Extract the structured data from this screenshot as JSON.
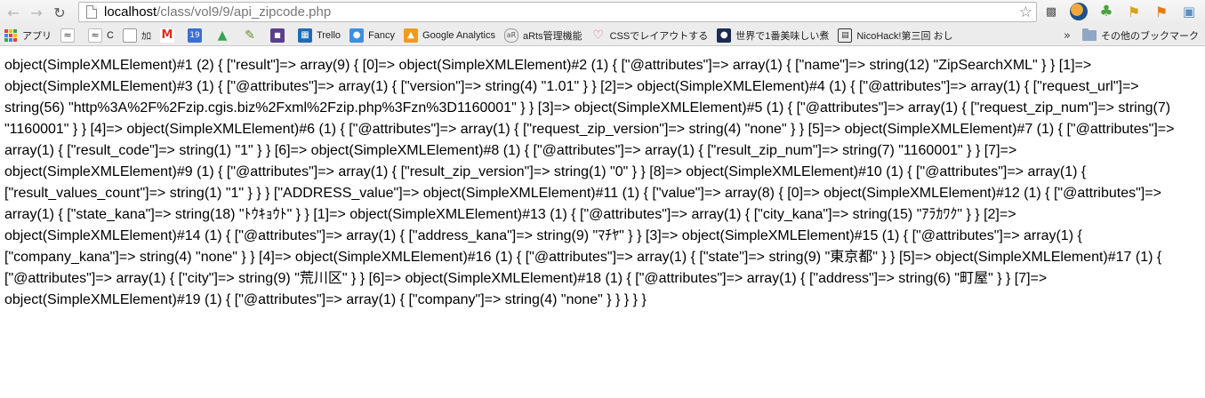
{
  "browser": {
    "url_host": "localhost",
    "url_path": "/class/vol9/9/api_zipcode.php",
    "back_icon": "back-arrow-icon",
    "forward_icon": "forward-arrow-icon",
    "reload_icon": "reload-icon",
    "star_icon": "bookmark-star-icon"
  },
  "bookmarks": [
    {
      "label": "アプリ",
      "icon": "apps-grid-icon"
    },
    {
      "label": "",
      "icon": "wave-icon"
    },
    {
      "label": "C",
      "icon": "wave-icon"
    },
    {
      "label": "ｶﾛ",
      "icon": "page-icon"
    },
    {
      "label": "",
      "icon": "gmail-icon"
    },
    {
      "label": "",
      "icon": "calendar-icon"
    },
    {
      "label": "",
      "icon": "drive-icon"
    },
    {
      "label": "",
      "icon": "pencil-icon"
    },
    {
      "label": "",
      "icon": "pixel-icon"
    },
    {
      "label": "Trello",
      "icon": "trello-icon"
    },
    {
      "label": "Fancy",
      "icon": "fancy-icon"
    },
    {
      "label": "Google Analytics",
      "icon": "analytics-icon"
    },
    {
      "label": "aRts管理機能",
      "icon": "arts-icon"
    },
    {
      "label": "CSSでレイアウトする",
      "icon": "heart-icon"
    },
    {
      "label": "世界で1番美味しい煮",
      "icon": "person-icon"
    },
    {
      "label": "NicoHack!第三回 おし",
      "icon": "nicohack-icon"
    }
  ],
  "other_bookmarks_label": "その他のブックマーク",
  "more_label": "»",
  "output_text": "object(SimpleXMLElement)#1 (2) { [\"result\"]=> array(9) { [0]=> object(SimpleXMLElement)#2 (1) { [\"@attributes\"]=> array(1) { [\"name\"]=> string(12) \"ZipSearchXML\" } } [1]=> object(SimpleXMLElement)#3 (1) { [\"@attributes\"]=> array(1) { [\"version\"]=> string(4) \"1.01\" } } [2]=> object(SimpleXMLElement)#4 (1) { [\"@attributes\"]=> array(1) { [\"request_url\"]=> string(56) \"http%3A%2F%2Fzip.cgis.biz%2Fxml%2Fzip.php%3Fzn%3D1160001\" } } [3]=> object(SimpleXMLElement)#5 (1) { [\"@attributes\"]=> array(1) { [\"request_zip_num\"]=> string(7) \"1160001\" } } [4]=> object(SimpleXMLElement)#6 (1) { [\"@attributes\"]=> array(1) { [\"request_zip_version\"]=> string(4) \"none\" } } [5]=> object(SimpleXMLElement)#7 (1) { [\"@attributes\"]=> array(1) { [\"result_code\"]=> string(1) \"1\" } } [6]=> object(SimpleXMLElement)#8 (1) { [\"@attributes\"]=> array(1) { [\"result_zip_num\"]=> string(7) \"1160001\" } } [7]=> object(SimpleXMLElement)#9 (1) { [\"@attributes\"]=> array(1) { [\"result_zip_version\"]=> string(1) \"0\" } } [8]=> object(SimpleXMLElement)#10 (1) { [\"@attributes\"]=> array(1) { [\"result_values_count\"]=> string(1) \"1\" } } } [\"ADDRESS_value\"]=> object(SimpleXMLElement)#11 (1) { [\"value\"]=> array(8) { [0]=> object(SimpleXMLElement)#12 (1) { [\"@attributes\"]=> array(1) { [\"state_kana\"]=> string(18) \"ﾄｳｷｮｳﾄ\" } } [1]=> object(SimpleXMLElement)#13 (1) { [\"@attributes\"]=> array(1) { [\"city_kana\"]=> string(15) \"ｱﾗｶﾜｸ\" } } [2]=> object(SimpleXMLElement)#14 (1) { [\"@attributes\"]=> array(1) { [\"address_kana\"]=> string(9) \"ﾏﾁﾔ\" } } [3]=> object(SimpleXMLElement)#15 (1) { [\"@attributes\"]=> array(1) { [\"company_kana\"]=> string(4) \"none\" } } [4]=> object(SimpleXMLElement)#16 (1) { [\"@attributes\"]=> array(1) { [\"state\"]=> string(9) \"東京都\" } } [5]=> object(SimpleXMLElement)#17 (1) { [\"@attributes\"]=> array(1) { [\"city\"]=> string(9) \"荒川区\" } } [6]=> object(SimpleXMLElement)#18 (1) { [\"@attributes\"]=> array(1) { [\"address\"]=> string(6) \"町屋\" } } [7]=> object(SimpleXMLElement)#19 (1) { [\"@attributes\"]=> array(1) { [\"company\"]=> string(4) \"none\" } } } } }"
}
